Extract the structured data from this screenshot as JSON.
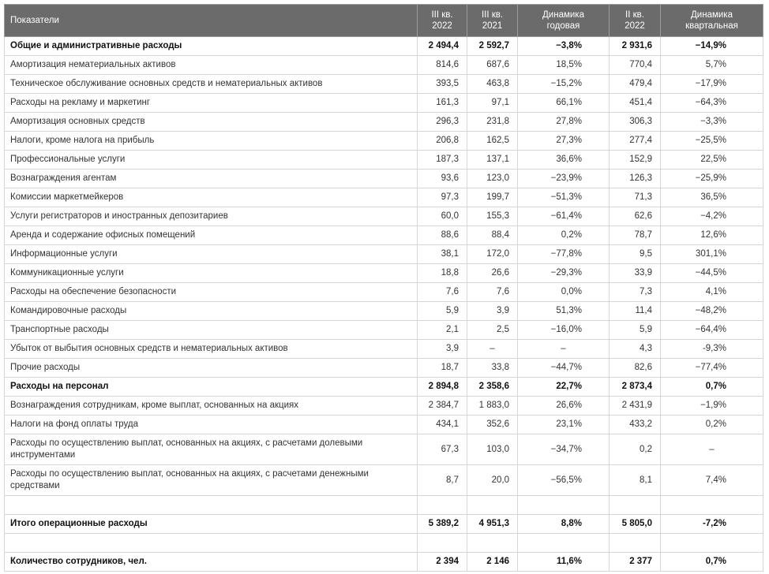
{
  "colors": {
    "header_background": "#6b6b6b",
    "header_text": "#ffffff",
    "grid": "#d6d6d6",
    "text": "#333333"
  },
  "table": {
    "columns": [
      {
        "label": "Показатели"
      },
      {
        "label": "III кв. 2022"
      },
      {
        "label": "III кв. 2021"
      },
      {
        "label": "Динамика годовая"
      },
      {
        "label": "II кв. 2022"
      },
      {
        "label": "Динамика квартальная"
      }
    ],
    "rows": [
      {
        "label": "Общие и административные расходы",
        "bold": true,
        "values": [
          "2 494,4",
          "2 592,7",
          "−3,8%",
          "2 931,6",
          "−14,9%"
        ]
      },
      {
        "label": "Амортизация нематериальных активов",
        "values": [
          "814,6",
          "687,6",
          "18,5%",
          "770,4",
          "5,7%"
        ]
      },
      {
        "label": "Техническое обслуживание основных средств и нематериальных активов",
        "values": [
          "393,5",
          "463,8",
          "−15,2%",
          "479,4",
          "−17,9%"
        ]
      },
      {
        "label": "Расходы на рекламу и маркетинг",
        "values": [
          "161,3",
          "97,1",
          "66,1%",
          "451,4",
          "−64,3%"
        ]
      },
      {
        "label": "Амортизация основных средств",
        "values": [
          "296,3",
          "231,8",
          "27,8%",
          "306,3",
          "−3,3%"
        ]
      },
      {
        "label": "Налоги, кроме налога на прибыль",
        "values": [
          "206,8",
          "162,5",
          "27,3%",
          "277,4",
          "−25,5%"
        ]
      },
      {
        "label": "Профессиональные услуги",
        "values": [
          "187,3",
          "137,1",
          "36,6%",
          "152,9",
          "22,5%"
        ]
      },
      {
        "label": "Вознаграждения агентам",
        "values": [
          "93,6",
          "123,0",
          "−23,9%",
          "126,3",
          "−25,9%"
        ]
      },
      {
        "label": "Комиссии маркетмейкеров",
        "values": [
          "97,3",
          "199,7",
          "−51,3%",
          "71,3",
          "36,5%"
        ]
      },
      {
        "label": "Услуги регистраторов и иностранных депозитариев",
        "values": [
          "60,0",
          "155,3",
          "−61,4%",
          "62,6",
          "−4,2%"
        ]
      },
      {
        "label": "Аренда и содержание офисных помещений",
        "values": [
          "88,6",
          "88,4",
          "0,2%",
          "78,7",
          "12,6%"
        ]
      },
      {
        "label": "Информационные услуги",
        "values": [
          "38,1",
          "172,0",
          "−77,8%",
          "9,5",
          "301,1%"
        ]
      },
      {
        "label": "Коммуникационные услуги",
        "values": [
          "18,8",
          "26,6",
          "−29,3%",
          "33,9",
          "−44,5%"
        ]
      },
      {
        "label": "Расходы на обеспечение безопасности",
        "values": [
          "7,6",
          "7,6",
          "0,0%",
          "7,3",
          "4,1%"
        ]
      },
      {
        "label": "Командировочные расходы",
        "values": [
          "5,9",
          "3,9",
          "51,3%",
          "11,4",
          "−48,2%"
        ]
      },
      {
        "label": "Транспортные расходы",
        "values": [
          "2,1",
          "2,5",
          "−16,0%",
          "5,9",
          "−64,4%"
        ]
      },
      {
        "label": "Убыток от выбытия основных средств и нематериальных активов",
        "values": [
          "3,9",
          "–",
          "–",
          "4,3",
          "-9,3%"
        ]
      },
      {
        "label": "Прочие расходы",
        "values": [
          "18,7",
          "33,8",
          "−44,7%",
          "82,6",
          "−77,4%"
        ]
      },
      {
        "label": "Расходы на персонал",
        "bold": true,
        "values": [
          "2 894,8",
          "2 358,6",
          "22,7%",
          "2 873,4",
          "0,7%"
        ]
      },
      {
        "label": "Вознаграждения сотрудникам, кроме выплат, основанных на акциях",
        "values": [
          "2 384,7",
          "1 883,0",
          "26,6%",
          "2 431,9",
          "−1,9%"
        ]
      },
      {
        "label": "Налоги на фонд оплаты труда",
        "values": [
          "434,1",
          "352,6",
          "23,1%",
          "433,2",
          "0,2%"
        ]
      },
      {
        "label": "Расходы по осуществлению выплат, основанных на акциях, с расчетами долевыми инструментами",
        "values": [
          "67,3",
          "103,0",
          "−34,7%",
          "0,2",
          "–"
        ]
      },
      {
        "label": "Расходы по осуществлению выплат, основанных на акциях, с расчетами денежными средствами",
        "values": [
          "8,7",
          "20,0",
          "−56,5%",
          "8,1",
          "7,4%"
        ]
      },
      {
        "spacer": true
      },
      {
        "label": "Итого операционные расходы",
        "bold": true,
        "values": [
          "5 389,2",
          "4 951,3",
          "8,8%",
          "5 805,0",
          "-7,2%"
        ]
      },
      {
        "spacer": true
      },
      {
        "label": "Количество сотрудников, чел.",
        "bold": true,
        "values": [
          "2 394",
          "2 146",
          "11,6%",
          "2 377",
          "0,7%"
        ]
      }
    ]
  }
}
